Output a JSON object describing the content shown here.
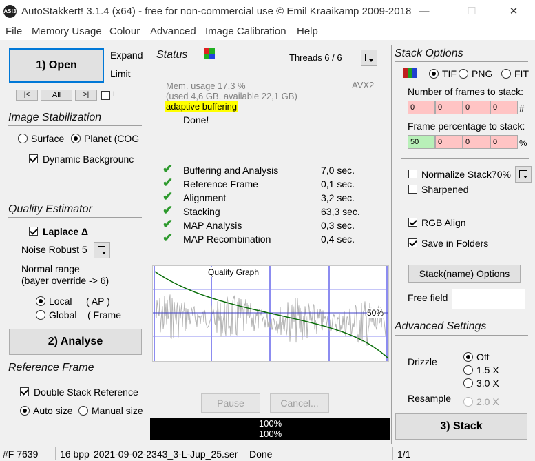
{
  "window": {
    "title": "AutoStakkert! 3.1.4 (x64) - free for non-commercial use © Emil Kraaikamp 2009-2018",
    "icon_text": "AS!3",
    "minimize": "—",
    "maximize": "☐",
    "close": "✕"
  },
  "menu": [
    "File",
    "Memory Usage",
    "Colour",
    "Advanced",
    "Image Calibration",
    "Help"
  ],
  "left": {
    "open_label": "1) Open",
    "expand": "Expand",
    "limit": "Limit",
    "nav": {
      "prev": "|<",
      "all": "All",
      "next": ">|",
      "l_label": "L"
    },
    "stabilization": {
      "title": "Image Stabilization",
      "surface": "Surface",
      "planet": "Planet (COG",
      "dynamic": "Dynamic Backgrounc"
    },
    "quality": {
      "title": "Quality Estimator",
      "laplace": "Laplace Δ",
      "noise": "Noise Robust 5",
      "range1": "Normal range",
      "range2": "(bayer override -> 6)",
      "local": "Local",
      "local_ap": "( AP )",
      "global": "Global",
      "global_frame": "( Frame"
    },
    "analyse_label": "2) Analyse",
    "reference": {
      "title": "Reference Frame",
      "double": "Double Stack Reference",
      "auto": "Auto size",
      "manual": "Manual size"
    }
  },
  "status": {
    "title": "Status",
    "threads": "Threads 6 / 6",
    "mem1": "Mem. usage 17,3 %",
    "mem2": "(used 4,6 GB, available 22,1 GB)",
    "adaptive": "adaptive buffering",
    "avx": "AVX2",
    "done": "Done!",
    "steps": [
      {
        "name": "Buffering and Analysis",
        "time": "7,0 sec."
      },
      {
        "name": "Reference Frame",
        "time": "0,1 sec."
      },
      {
        "name": "Alignment",
        "time": "3,2 sec."
      },
      {
        "name": "Stacking",
        "time": "63,3 sec."
      },
      {
        "name": "MAP Analysis",
        "time": "0,3 sec."
      },
      {
        "name": "MAP Recombination",
        "time": "0,4 sec."
      }
    ],
    "graph_title": "Quality Graph",
    "graph_pct": "50%",
    "pause": "Pause",
    "cancel": "Cancel...",
    "progress1": "100%",
    "progress2": "100%",
    "progress_value": 1.0,
    "graph_colors": {
      "noise": "#b4b4b4",
      "curve": "#0a6e0a",
      "markers": "#8c8cf0",
      "line50": "#3c3cc8"
    }
  },
  "stack": {
    "title": "Stack Options",
    "tif": "TIF",
    "png": "PNG",
    "fit": "FIT",
    "frames_label": "Number of frames to stack:",
    "frames": [
      "0",
      "0",
      "0",
      "0"
    ],
    "hash": "#",
    "pct_label": "Frame percentage to stack:",
    "pct": [
      "50",
      "0",
      "0",
      "0"
    ],
    "pct_sign": "%",
    "normalize": "Normalize Stack70%",
    "sharpened": "Sharpened",
    "rgb_align": "RGB Align",
    "save_folders": "Save in Folders",
    "name_options": "Stack(name) Options",
    "free_field": "Free field",
    "free_value": "",
    "advanced_title": "Advanced Settings",
    "drizzle": "Drizzle",
    "off": "Off",
    "x15": "1.5 X",
    "x30": "3.0 X",
    "resample": "Resample",
    "x20": "2.0 X",
    "stack_label": "3) Stack"
  },
  "statusbar": {
    "frame": "#F 7639",
    "bpp": "16 bpp",
    "file": "2021-09-02-2343_3-L-Jup_25.ser",
    "state": "Done",
    "page": "1/1"
  }
}
